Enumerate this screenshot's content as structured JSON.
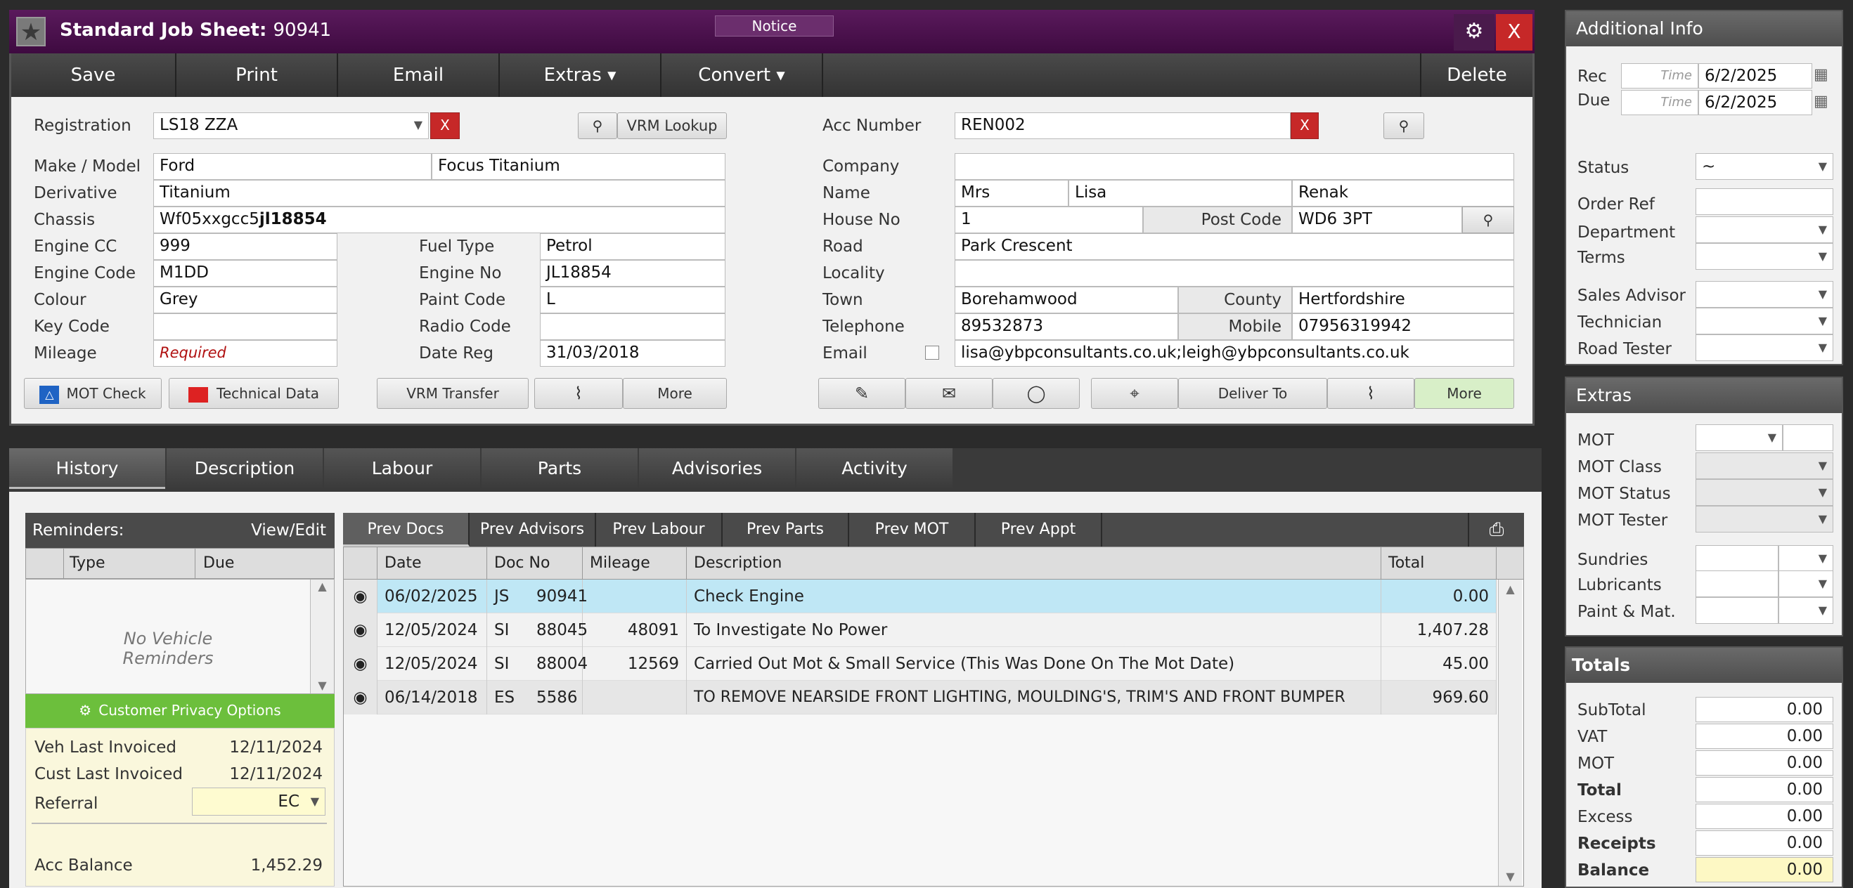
{
  "title": {
    "label": "Standard Job Sheet:",
    "number": "90941",
    "notice": "Notice",
    "close": "X"
  },
  "toolbar": {
    "save": "Save",
    "print": "Print",
    "email": "Email",
    "extras": "Extras",
    "convert": "Convert",
    "delete": "Delete"
  },
  "vehicle": {
    "registration_label": "Registration",
    "registration": "LS18 ZZA",
    "vrm_lookup": "VRM Lookup",
    "make_model_label": "Make / Model",
    "make": "Ford",
    "model": "Focus Titanium",
    "derivative_label": "Derivative",
    "derivative": "Titanium",
    "chassis_label": "Chassis",
    "chassis_prefix": "Wf05xxgcc5",
    "chassis_bold": "jl18854",
    "engine_cc_label": "Engine CC",
    "engine_cc": "999",
    "fuel_type_label": "Fuel Type",
    "fuel_type": "Petrol",
    "engine_code_label": "Engine Code",
    "engine_code": "M1DD",
    "engine_no_label": "Engine No",
    "engine_no": "JL18854",
    "colour_label": "Colour",
    "colour": "Grey",
    "paint_code_label": "Paint Code",
    "paint_code": "L",
    "key_code_label": "Key Code",
    "key_code": "",
    "radio_code_label": "Radio Code",
    "radio_code": "",
    "mileage_label": "Mileage",
    "mileage": "Required",
    "date_reg_label": "Date Reg",
    "date_reg": "31/03/2018",
    "mot_check": "MOT Check",
    "technical_data": "Technical Data",
    "vrm_transfer": "VRM Transfer",
    "more": "More"
  },
  "customer": {
    "acc_number_label": "Acc Number",
    "acc_number": "REN002",
    "company_label": "Company",
    "company": "",
    "name_label": "Name",
    "title": "Mrs",
    "first": "Lisa",
    "last": "Renak",
    "house_no_label": "House No",
    "house_no": "1",
    "post_code_label": "Post Code",
    "post_code": "WD6 3PT",
    "road_label": "Road",
    "road": "Park Crescent",
    "locality_label": "Locality",
    "locality": "",
    "town_label": "Town",
    "town": "Borehamwood",
    "county_label": "County",
    "county": "Hertfordshire",
    "telephone_label": "Telephone",
    "telephone": "89532873",
    "mobile_label": "Mobile",
    "mobile": "07956319942",
    "email_label": "Email",
    "email": "lisa@ybpconsultants.co.uk;leigh@ybpconsultants.co.uk",
    "deliver_to": "Deliver To",
    "more": "More"
  },
  "tabs": [
    "History",
    "Description",
    "Labour",
    "Parts",
    "Advisories",
    "Activity"
  ],
  "reminders": {
    "title": "Reminders:",
    "view_edit": "View/Edit",
    "col_type": "Type",
    "col_due": "Due",
    "empty_line1": "No Vehicle",
    "empty_line2": "Reminders",
    "privacy": "Customer Privacy Options",
    "veh_last_label": "Veh Last Invoiced",
    "veh_last": "12/11/2024",
    "cust_last_label": "Cust Last Invoiced",
    "cust_last": "12/11/2024",
    "referral_label": "Referral",
    "referral": "EC",
    "acc_balance_label": "Acc Balance",
    "acc_balance": "1,452.29"
  },
  "subtabs": [
    "Prev Docs",
    "Prev Advisors",
    "Prev Labour",
    "Prev Parts",
    "Prev MOT",
    "Prev Appt"
  ],
  "grid": {
    "headers": {
      "date": "Date",
      "doc": "Doc No",
      "mileage": "Mileage",
      "desc": "Description",
      "total": "Total"
    },
    "rows": [
      {
        "date": "06/02/2025",
        "type": "JS",
        "doc": "90941",
        "mileage": "",
        "desc": "Check Engine",
        "total": "0.00"
      },
      {
        "date": "12/05/2024",
        "type": "SI",
        "doc": "88045",
        "mileage": "48091",
        "desc": "To Investigate No Power",
        "total": "1,407.28"
      },
      {
        "date": "12/05/2024",
        "type": "SI",
        "doc": "88004",
        "mileage": "12569",
        "desc": "Carried Out Mot & Small Service (This Was Done On The Mot Date)",
        "total": "45.00"
      },
      {
        "date": "06/14/2018",
        "type": "ES",
        "doc": "5586",
        "mileage": "",
        "desc": "TO REMOVE NEARSIDE FRONT LIGHTING, MOULDING'S, TRIM'S AND FRONT BUMPER",
        "total": "969.60"
      }
    ]
  },
  "additional": {
    "title": "Additional Info",
    "rec_label": "Rec",
    "due_label": "Due",
    "time_ph": "Time",
    "rec": "6/2/2025",
    "due": "6/2/2025",
    "status_label": "Status",
    "status": "~",
    "order_ref_label": "Order Ref",
    "department_label": "Department",
    "terms_label": "Terms",
    "sales_advisor_label": "Sales Advisor",
    "technician_label": "Technician",
    "road_tester_label": "Road Tester"
  },
  "extras": {
    "title": "Extras",
    "mot_label": "MOT",
    "mot_class_label": "MOT Class",
    "mot_status_label": "MOT Status",
    "mot_tester_label": "MOT Tester",
    "sundries_label": "Sundries",
    "lubricants_label": "Lubricants",
    "paint_label": "Paint & Mat."
  },
  "totals": {
    "title": "Totals",
    "subtotal_label": "SubTotal",
    "subtotal": "0.00",
    "vat_label": "VAT",
    "vat": "0.00",
    "mot_label": "MOT",
    "mot": "0.00",
    "total_label": "Total",
    "total": "0.00",
    "excess_label": "Excess",
    "excess": "0.00",
    "receipts_label": "Receipts",
    "receipts": "0.00",
    "balance_label": "Balance",
    "balance": "0.00"
  }
}
